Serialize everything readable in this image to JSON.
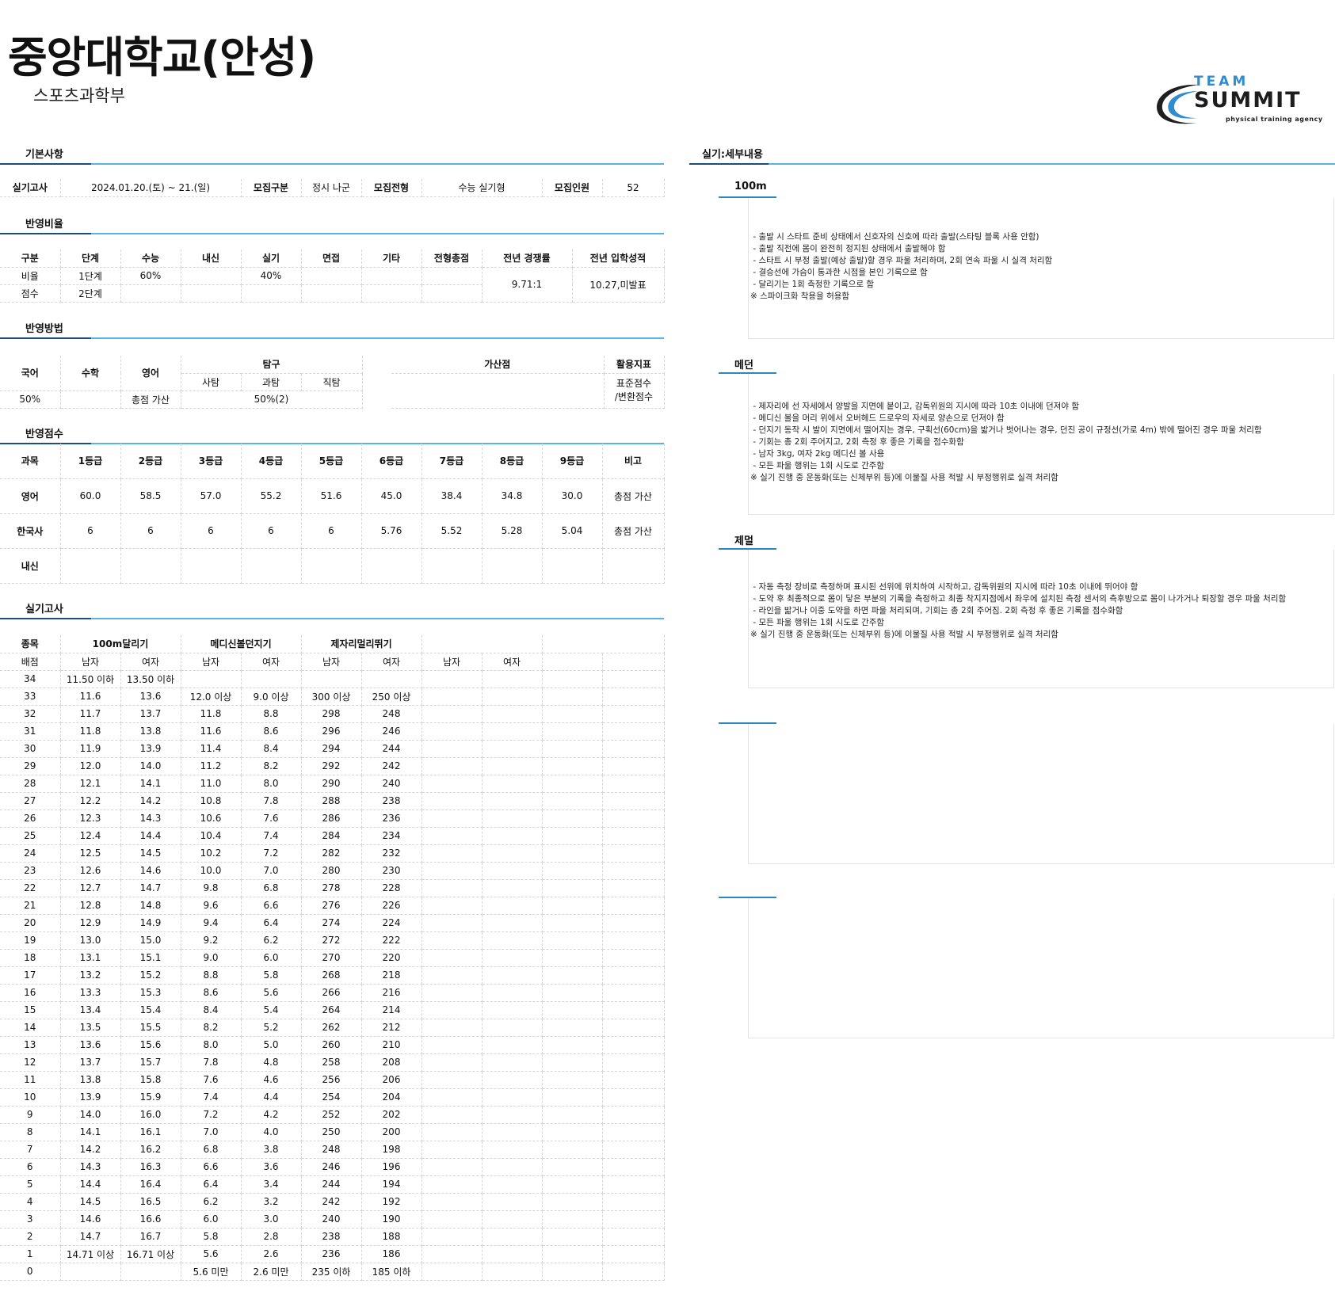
{
  "header": {
    "title": "중앙대학교(안성)",
    "subtitle": "스포츠과학부",
    "logo_team": "TEAM",
    "logo_summit": "SUMMIT",
    "logo_tagline": "physical training agency"
  },
  "sections": {
    "basic": "기본사항",
    "ratio": "반영비율",
    "method": "반영방법",
    "score": "반영점수",
    "practical": "실기고사",
    "detail": "실기:세부내용"
  },
  "basic": {
    "exam_label": "실기고사",
    "exam_date": "2024.01.20.(토) ~ 21.(일)",
    "type_label": "모집구분",
    "type_value": "정시 나군",
    "track_label": "모집전형",
    "track_value": "수능 실기형",
    "quota_label": "모집인원",
    "quota_value": "52"
  },
  "ratio": {
    "headers": [
      "구분",
      "단계",
      "수능",
      "내신",
      "실기",
      "면접",
      "기타",
      "전형총점",
      "전년 경쟁률",
      "전년 입학성적"
    ],
    "row1": [
      "비율",
      "1단계",
      "60%",
      "",
      "40%",
      "",
      "",
      ""
    ],
    "row2": [
      "점수",
      "2단계",
      "",
      "",
      "",
      "",
      "",
      ""
    ],
    "competition": "9.71:1",
    "admission": "10.27,미발표"
  },
  "method": {
    "korean": "국어",
    "math": "수학",
    "english": "영어",
    "inquiry": "탐구",
    "social": "사탐",
    "science": "과탐",
    "vocational": "직탐",
    "korean_val": "50%",
    "math_val": "",
    "english_val": "총점 가산",
    "inquiry_val": "50%(2)",
    "bonus": "가산점",
    "index": "활용지표",
    "index_val1": "표준점수",
    "index_val2": "/변환점수"
  },
  "score": {
    "headers": [
      "과목",
      "1등급",
      "2등급",
      "3등급",
      "4등급",
      "5등급",
      "6등급",
      "7등급",
      "8등급",
      "9등급",
      "비고"
    ],
    "rows": [
      [
        "영어",
        "60.0",
        "58.5",
        "57.0",
        "55.2",
        "51.6",
        "45.0",
        "38.4",
        "34.8",
        "30.0",
        "총점 가산"
      ],
      [
        "한국사",
        "6",
        "6",
        "6",
        "6",
        "6",
        "5.76",
        "5.52",
        "5.28",
        "5.04",
        "총점 가산"
      ],
      [
        "내신",
        "",
        "",
        "",
        "",
        "",
        "",
        "",
        "",
        "",
        ""
      ]
    ]
  },
  "practical": {
    "event_label": "종목",
    "points_label": "배점",
    "events": [
      "100m달리기",
      "메디신볼던지기",
      "제자리멀리뛰기"
    ],
    "male": "남자",
    "female": "여자",
    "rows": [
      [
        "34",
        "11.50 이하",
        "13.50 이하",
        "",
        "",
        "",
        ""
      ],
      [
        "33",
        "11.6",
        "13.6",
        "12.0 이상",
        "9.0 이상",
        "300 이상",
        "250 이상"
      ],
      [
        "32",
        "11.7",
        "13.7",
        "11.8",
        "8.8",
        "298",
        "248"
      ],
      [
        "31",
        "11.8",
        "13.8",
        "11.6",
        "8.6",
        "296",
        "246"
      ],
      [
        "30",
        "11.9",
        "13.9",
        "11.4",
        "8.4",
        "294",
        "244"
      ],
      [
        "29",
        "12.0",
        "14.0",
        "11.2",
        "8.2",
        "292",
        "242"
      ],
      [
        "28",
        "12.1",
        "14.1",
        "11.0",
        "8.0",
        "290",
        "240"
      ],
      [
        "27",
        "12.2",
        "14.2",
        "10.8",
        "7.8",
        "288",
        "238"
      ],
      [
        "26",
        "12.3",
        "14.3",
        "10.6",
        "7.6",
        "286",
        "236"
      ],
      [
        "25",
        "12.4",
        "14.4",
        "10.4",
        "7.4",
        "284",
        "234"
      ],
      [
        "24",
        "12.5",
        "14.5",
        "10.2",
        "7.2",
        "282",
        "232"
      ],
      [
        "23",
        "12.6",
        "14.6",
        "10.0",
        "7.0",
        "280",
        "230"
      ],
      [
        "22",
        "12.7",
        "14.7",
        "9.8",
        "6.8",
        "278",
        "228"
      ],
      [
        "21",
        "12.8",
        "14.8",
        "9.6",
        "6.6",
        "276",
        "226"
      ],
      [
        "20",
        "12.9",
        "14.9",
        "9.4",
        "6.4",
        "274",
        "224"
      ],
      [
        "19",
        "13.0",
        "15.0",
        "9.2",
        "6.2",
        "272",
        "222"
      ],
      [
        "18",
        "13.1",
        "15.1",
        "9.0",
        "6.0",
        "270",
        "220"
      ],
      [
        "17",
        "13.2",
        "15.2",
        "8.8",
        "5.8",
        "268",
        "218"
      ],
      [
        "16",
        "13.3",
        "15.3",
        "8.6",
        "5.6",
        "266",
        "216"
      ],
      [
        "15",
        "13.4",
        "15.4",
        "8.4",
        "5.4",
        "264",
        "214"
      ],
      [
        "14",
        "13.5",
        "15.5",
        "8.2",
        "5.2",
        "262",
        "212"
      ],
      [
        "13",
        "13.6",
        "15.6",
        "8.0",
        "5.0",
        "260",
        "210"
      ],
      [
        "12",
        "13.7",
        "15.7",
        "7.8",
        "4.8",
        "258",
        "208"
      ],
      [
        "11",
        "13.8",
        "15.8",
        "7.6",
        "4.6",
        "256",
        "206"
      ],
      [
        "10",
        "13.9",
        "15.9",
        "7.4",
        "4.4",
        "254",
        "204"
      ],
      [
        "9",
        "14.0",
        "16.0",
        "7.2",
        "4.2",
        "252",
        "202"
      ],
      [
        "8",
        "14.1",
        "16.1",
        "7.0",
        "4.0",
        "250",
        "200"
      ],
      [
        "7",
        "14.2",
        "16.2",
        "6.8",
        "3.8",
        "248",
        "198"
      ],
      [
        "6",
        "14.3",
        "16.3",
        "6.6",
        "3.6",
        "246",
        "196"
      ],
      [
        "5",
        "14.4",
        "16.4",
        "6.4",
        "3.4",
        "244",
        "194"
      ],
      [
        "4",
        "14.5",
        "16.5",
        "6.2",
        "3.2",
        "242",
        "192"
      ],
      [
        "3",
        "14.6",
        "16.6",
        "6.0",
        "3.0",
        "240",
        "190"
      ],
      [
        "2",
        "14.7",
        "16.7",
        "5.8",
        "2.8",
        "238",
        "188"
      ],
      [
        "1",
        "14.71 이상",
        "16.71 이상",
        "5.6",
        "2.6",
        "236",
        "186"
      ],
      [
        "0",
        "",
        "",
        "5.6 미만",
        "2.6 미만",
        "235 이하",
        "185 이하"
      ]
    ]
  },
  "details": [
    {
      "title": "100m",
      "text": " - 출발 시 스타트 준비 상태에서 신호자의 신호에 따라 출발(스타팅 블록 사용 안함)\n - 출발 직전에 몸이 완전히 정지된 상태에서 출발해야 함\n - 스타트 시 부정 출발(예상 출발)할 경우 파울 처리하며, 2회 연속 파울 시 실격 처리함\n - 결승선에 가슴이 통과한 시점을 본인 기록으로 함\n - 달리기는 1회 측정한 기록으로 함\n※ 스파이크화 착용을 허용함"
    },
    {
      "title": "메던",
      "text": " - 제자리에 선 자세에서 양발을 지면에 붙이고, 감독위원의 지시에 따라 10초 이내에 던져야 함\n - 메디신 볼을 머리 위에서 오버헤드 드로우의 자세로 양손으로 던져야 함\n - 던지기 동작 시 발이 지면에서 떨어지는 경우, 구획선(60cm)을 밟거나 벗어나는 경우, 던진 공이 규정선(가로 4m) 밖에 떨어진 경우 파울 처리함\n - 기회는 총 2회 주어지고, 2회 측정 후 좋은 기록을 점수화함\n - 남자 3kg, 여자 2kg 메디신 볼 사용\n - 모든 파울 행위는 1회 시도로 간주함\n※ 실기 진행 중 운동화(또는 신체부위 등)에 이물질 사용 적발 시 부정행위로 실격 처리함"
    },
    {
      "title": "제멀",
      "text": " - 자동 측정 장비로 측정하며 표시된 선위에 위치하여 시작하고, 감독위원의 지시에 따라 10초 이내에 뛰어야 함\n - 도약 후 최종적으로 몸이 닿은 부분의 기록을 측정하고 최종 착지지점에서 좌우에 설치된 측정 센서의 측후방으로 몸이 나가거나 퇴장할 경우 파울 처리함\n - 라인을 밟거나 이중 도약을 하면 파울 처리되며, 기회는 총 2회 주어짐. 2회 측정 후 좋은 기록을 점수화함\n - 모든 파울 행위는 1회 시도로 간주함\n※ 실기 진행 중 운동화(또는 신체부위 등)에 이물질 사용 적발 시 부정행위로 실격 처리함"
    },
    {
      "title": "",
      "text": ""
    },
    {
      "title": "",
      "text": ""
    }
  ]
}
